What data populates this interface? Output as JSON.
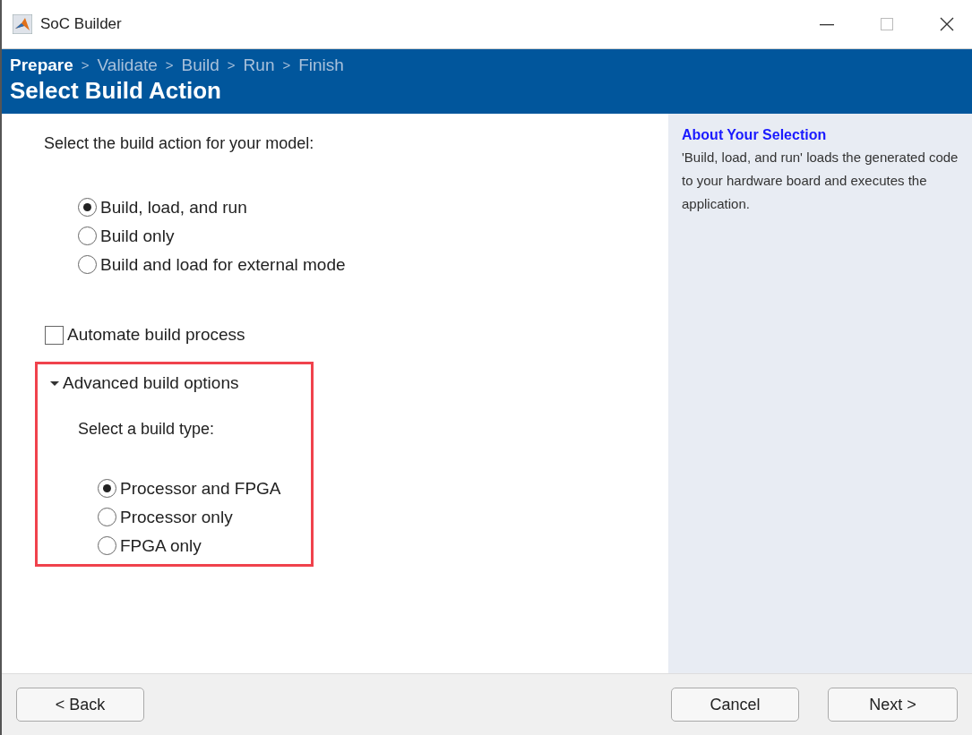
{
  "window": {
    "title": "SoC Builder"
  },
  "steps": [
    {
      "label": "Prepare",
      "selected": true
    },
    {
      "label": "Validate",
      "selected": false
    },
    {
      "label": "Build",
      "selected": false
    },
    {
      "label": "Run",
      "selected": false
    },
    {
      "label": "Finish",
      "selected": false
    }
  ],
  "step_separator": ">",
  "page_title": "Select Build Action",
  "prompt": "Select the build action for your model:",
  "build_actions": [
    {
      "label": "Build, load, and run",
      "selected": true
    },
    {
      "label": "Build only",
      "selected": false
    },
    {
      "label": "Build and load for external mode",
      "selected": false
    }
  ],
  "automate": {
    "label": "Automate build process",
    "checked": false
  },
  "advanced": {
    "label": "Advanced build options",
    "expanded": true,
    "prompt": "Select a build type:",
    "build_types": [
      {
        "label": "Processor and FPGA",
        "selected": true
      },
      {
        "label": "Processor only",
        "selected": false
      },
      {
        "label": "FPGA only",
        "selected": false
      }
    ]
  },
  "about": {
    "title": "About Your Selection",
    "text": "'Build, load, and run' loads the generated code to your hardware board and executes the application."
  },
  "buttons": {
    "back": "< Back",
    "cancel": "Cancel",
    "next": "Next >"
  }
}
